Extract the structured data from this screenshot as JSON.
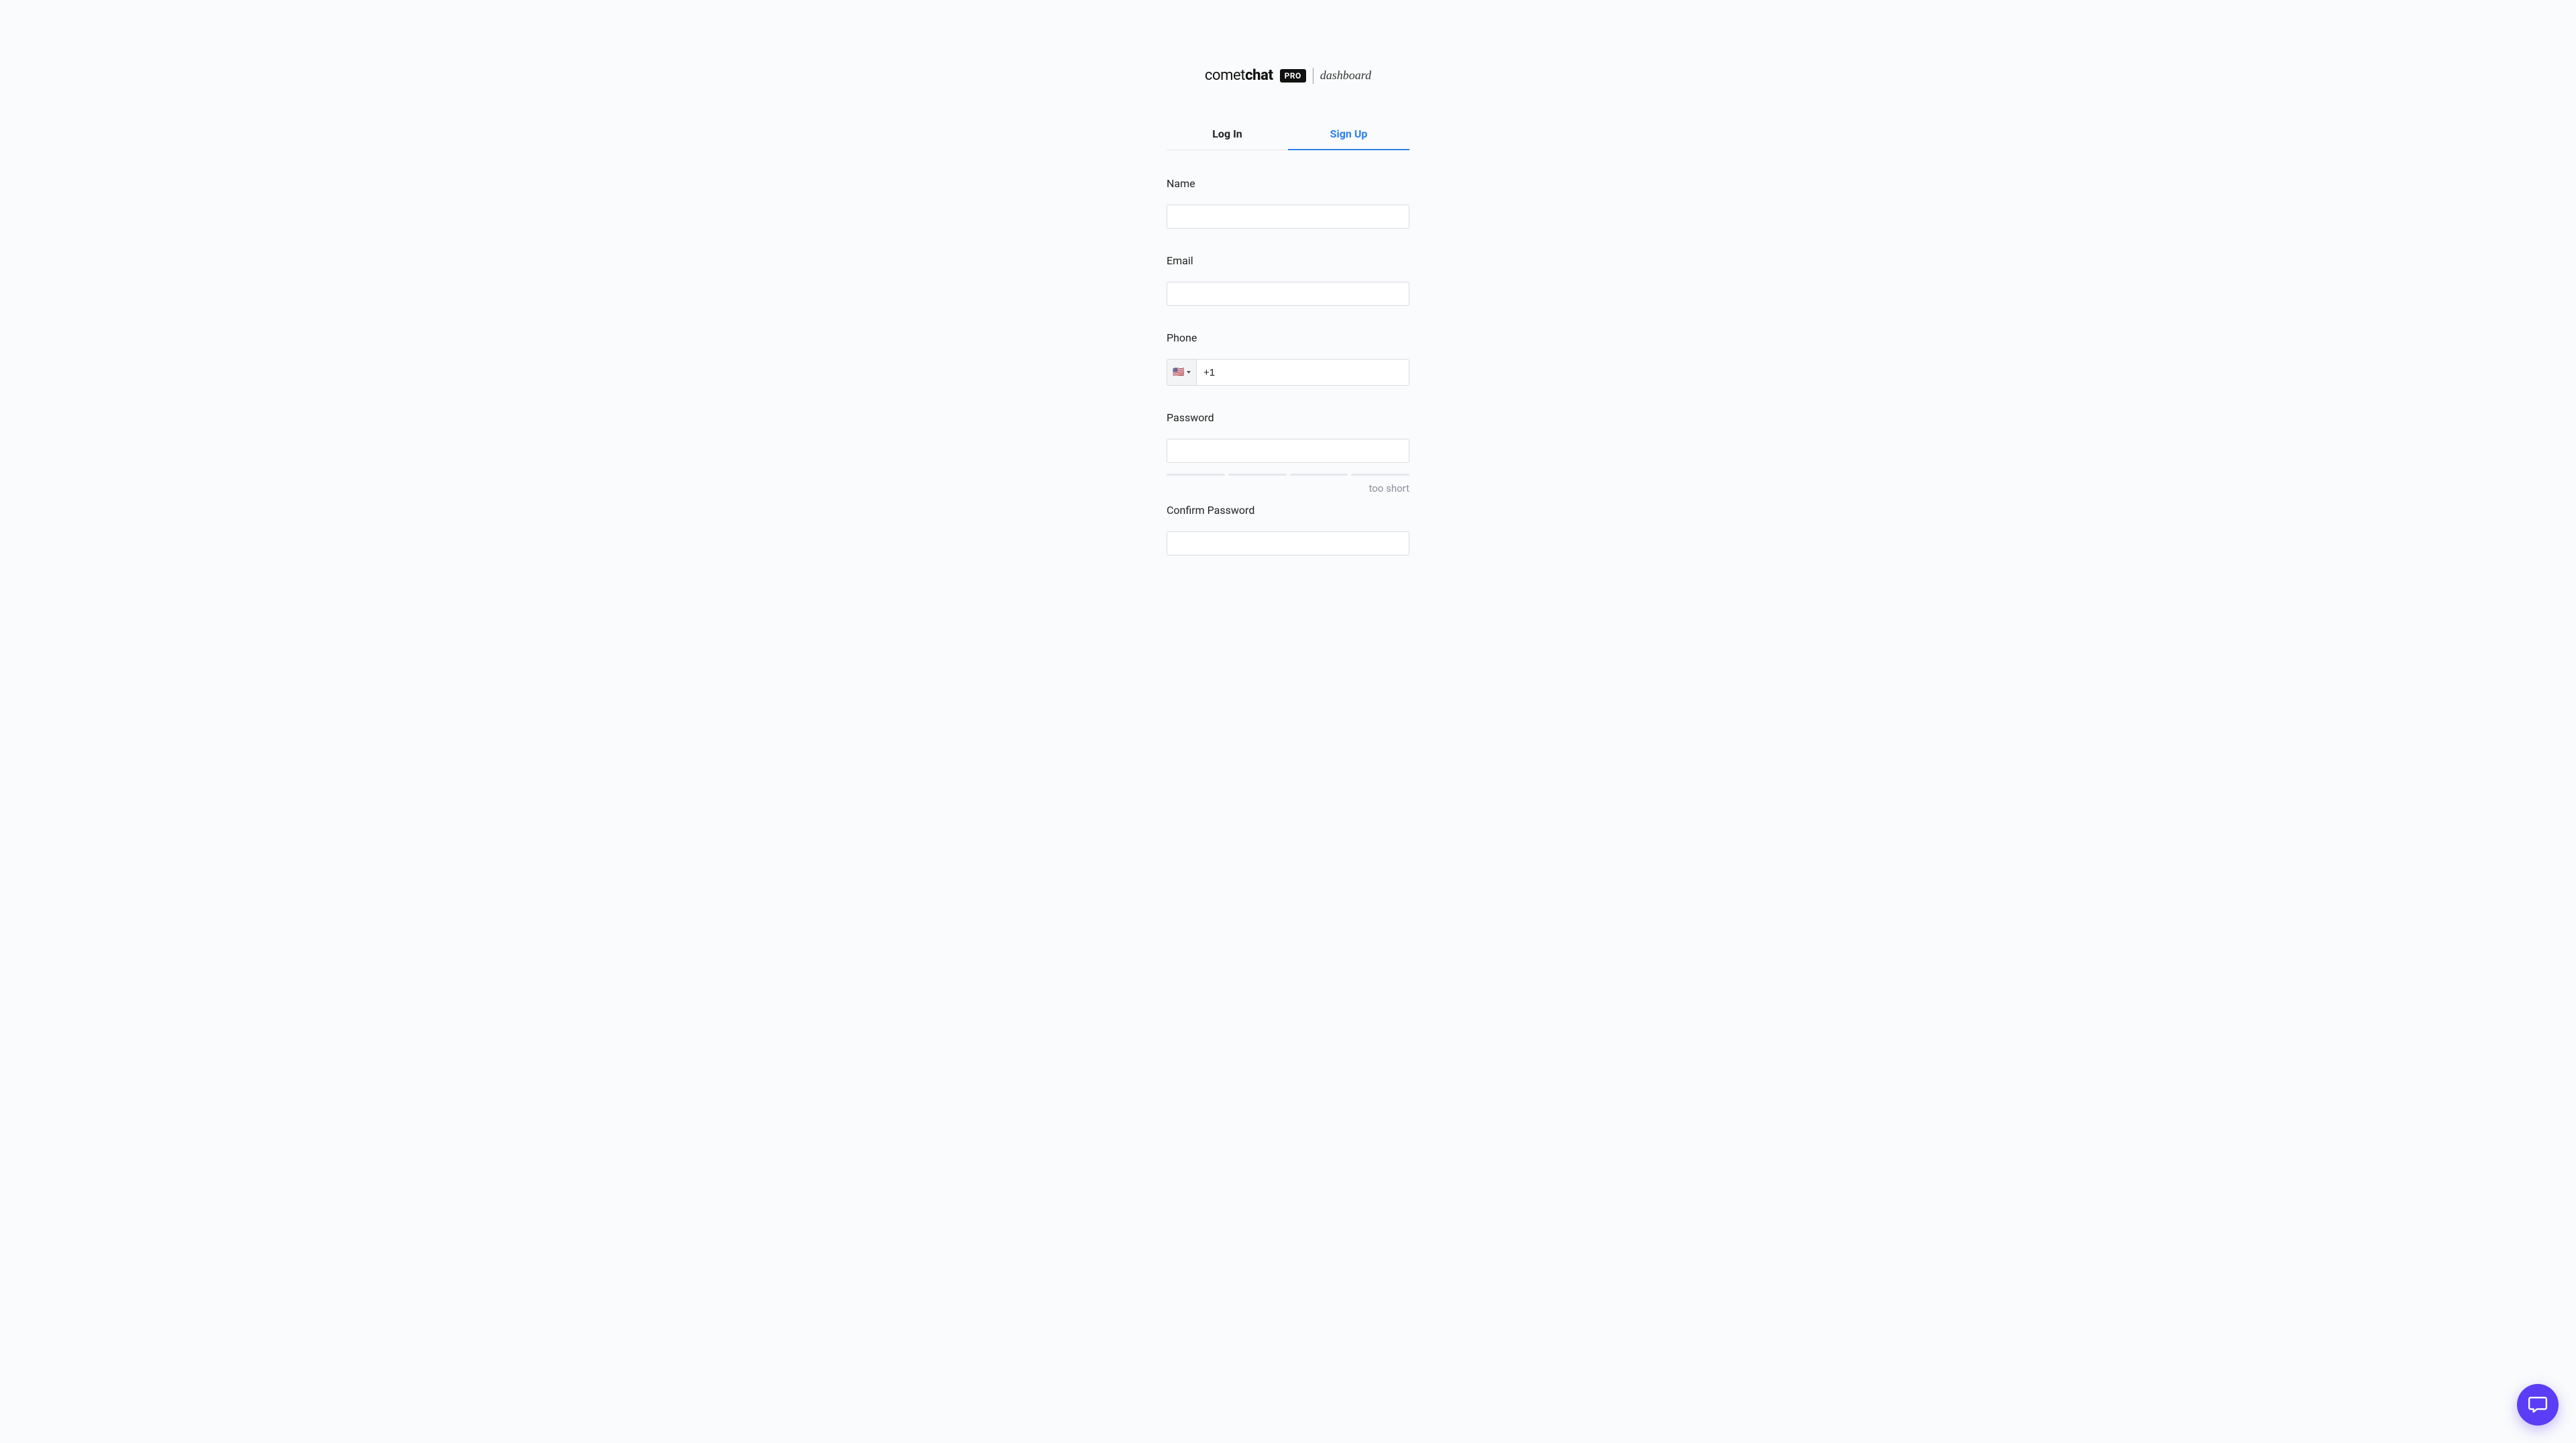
{
  "logo": {
    "brand_light": "comet",
    "brand_bold": "chat",
    "pro_badge": "PRO",
    "dashboard_text": "dashboard"
  },
  "tabs": {
    "login_label": "Log In",
    "signup_label": "Sign Up",
    "active": "signup"
  },
  "form": {
    "name": {
      "label": "Name",
      "value": ""
    },
    "email": {
      "label": "Email",
      "value": ""
    },
    "phone": {
      "label": "Phone",
      "country_flag": "🇺🇸",
      "value": "+1"
    },
    "password": {
      "label": "Password",
      "value": "",
      "strength_hint": "too short",
      "strength_level": 0
    },
    "confirm_password": {
      "label": "Confirm Password",
      "value": ""
    }
  },
  "colors": {
    "accent": "#2f80ed",
    "chat_fab": "#5b3df5"
  }
}
